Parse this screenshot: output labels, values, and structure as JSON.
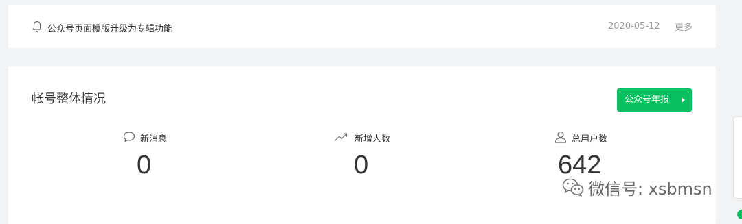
{
  "notice": {
    "icon": "bell-icon",
    "text": "公众号页面模版升级为专辑功能",
    "date": "2020-05-12",
    "more_label": "更多"
  },
  "overview": {
    "title": "帐号整体情况",
    "annual_report_label": "公众号年报",
    "stats": [
      {
        "icon": "message-bubble-icon",
        "label": "新消息",
        "value": "0"
      },
      {
        "icon": "trend-up-icon",
        "label": "新增人数",
        "value": "0"
      },
      {
        "icon": "user-icon",
        "label": "总用户数",
        "value": "642"
      }
    ]
  },
  "watermark": {
    "text": "微信号: xsbmsn"
  },
  "colors": {
    "accent": "#07c160",
    "background": "#f2f3f5",
    "card": "#ffffff",
    "text": "#353535",
    "muted": "#9a9a9a"
  }
}
